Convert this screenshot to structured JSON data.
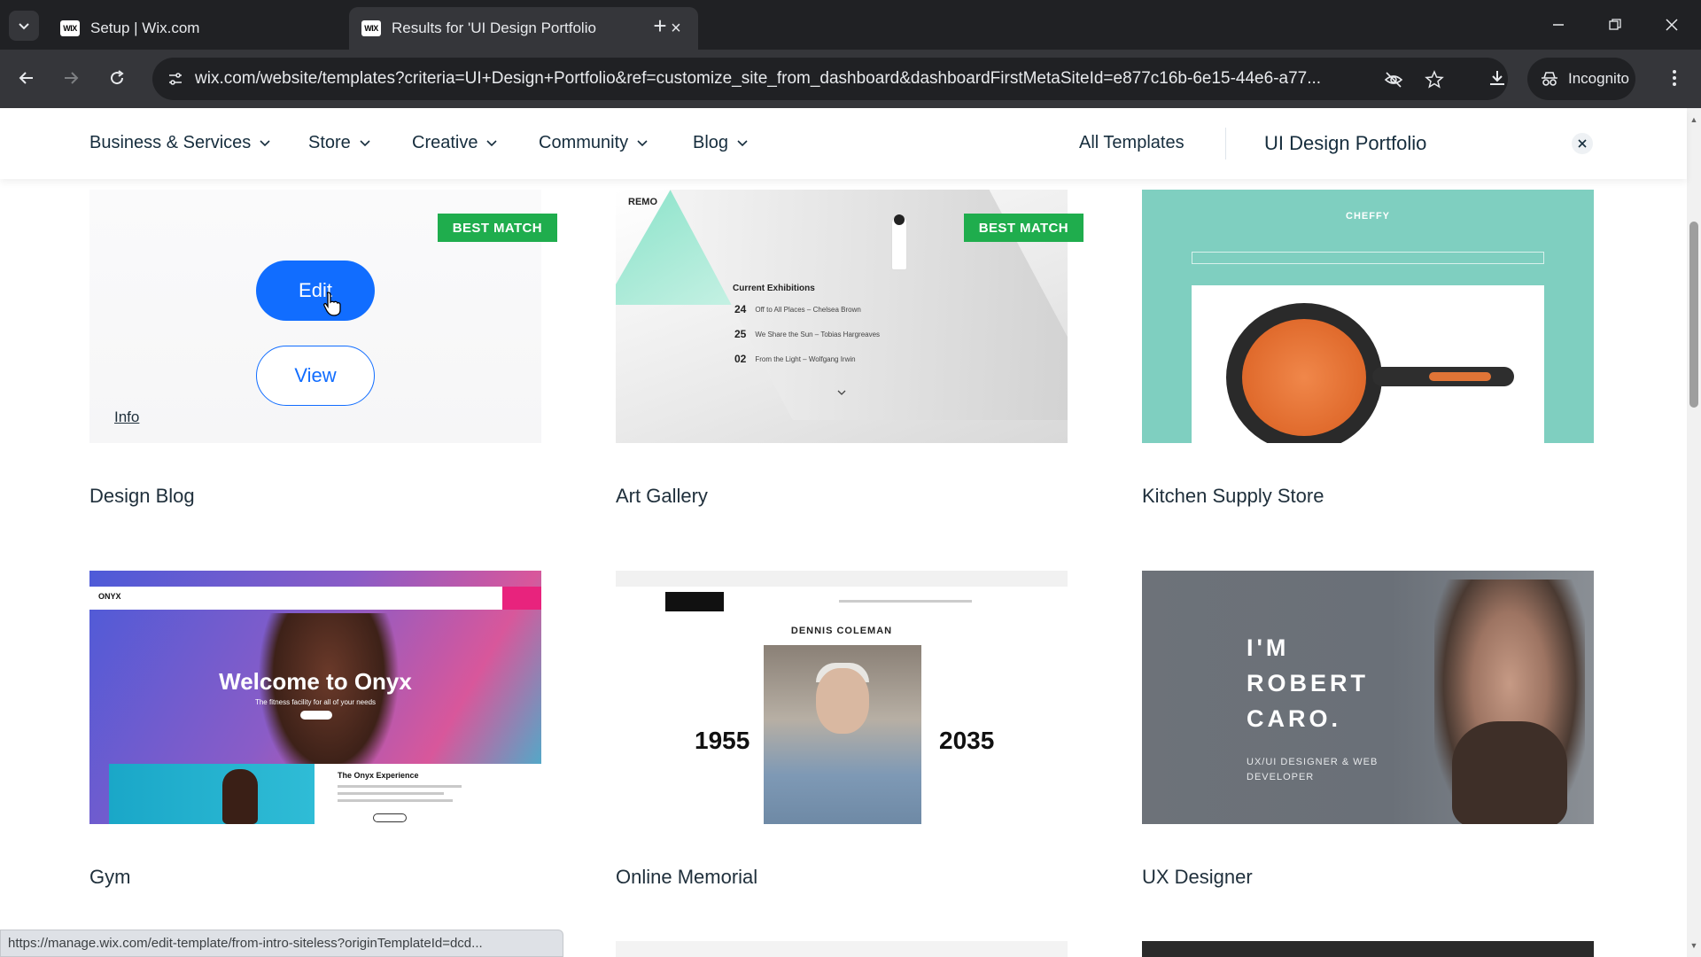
{
  "browser": {
    "tabs": [
      {
        "title": "Setup | Wix.com",
        "favicon": "WIX",
        "active": false
      },
      {
        "title": "Results for 'UI Design Portfolio",
        "favicon": "WIX",
        "active": true
      }
    ],
    "url": "wix.com/website/templates?criteria=UI+Design+Portfolio&ref=customize_site_from_dashboard&dashboardFirstMetaSiteId=e877c16b-6e15-44e6-a77...",
    "profile_label": "Incognito",
    "status_url": "https://manage.wix.com/edit-template/from-intro-siteless?originTemplateId=dcd..."
  },
  "nav": {
    "categories": [
      "Business & Services",
      "Store",
      "Creative",
      "Community",
      "Blog"
    ],
    "all_templates": "All Templates",
    "search_term": "UI Design Portfolio"
  },
  "cards": [
    {
      "title": "Design Blog",
      "badge": "BEST MATCH",
      "edit_label": "Edit",
      "view_label": "View",
      "info_label": "Info"
    },
    {
      "title": "Art Gallery",
      "badge": "BEST MATCH"
    },
    {
      "title": "Kitchen Supply Store"
    },
    {
      "title": "Gym"
    },
    {
      "title": "Online Memorial"
    },
    {
      "title": "UX Designer"
    }
  ],
  "previews": {
    "art": {
      "logo": "REMO",
      "heading": "Current Exhibitions",
      "rows": [
        {
          "day": "24",
          "text": "Off to All Places – Chelsea Brown"
        },
        {
          "day": "25",
          "text": "We Share the Sun – Tobias Hargreaves"
        },
        {
          "day": "02",
          "text": "From the Light – Wolfgang Irwin"
        }
      ]
    },
    "kitchen": {
      "logo": "CHEFFY"
    },
    "gym": {
      "logo": "ONYX",
      "headline": "Welcome to Onyx",
      "subline": "The fitness facility for all of your needs",
      "card_title": "The Onyx Experience"
    },
    "memorial": {
      "name": "DENNIS COLEMAN",
      "year_born": "1955",
      "year_died": "2035"
    },
    "ux": {
      "line1": "I'M",
      "line2": "ROBERT",
      "line3": "CARO.",
      "subtitle": "UX/UI DESIGNER & WEB DEVELOPER"
    }
  },
  "colors": {
    "accent": "#116dff",
    "badge": "#1fad4d",
    "chrome_dark": "#202124",
    "chrome_mid": "#35363a"
  }
}
